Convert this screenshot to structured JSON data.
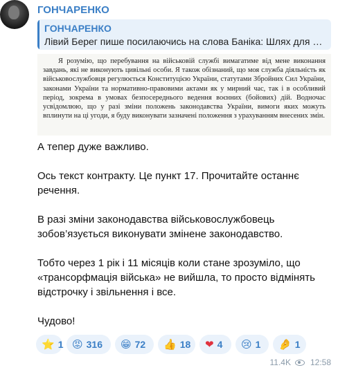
{
  "channel": {
    "sender_name": "ГОНЧАРЕНКО"
  },
  "reply": {
    "name": "ГОНЧАРЕНКО",
    "text": "Лівий Берег пише посилаючись на слова Баніка: Шлях для звільнення — не служба, а отримання відстрочки…"
  },
  "document_excerpt": {
    "text": "Я розумію, що перебування на військовій службі вимагатиме від мене виконання завдань, які не виконують цивільні особи. Я також обізнаний, що моя служба діяльність як військовослужбовця регулюється Конституцією України, статутами Збройних Сил України, законами України та нормативно-правовими актами як у мирний час, так і в особливий період, зокрема в умовах безпосереднього ведення воєнних (бойових) дій. Водночас усвідомлюю, що у разі зміни положень законодавства України, вимоги яких можуть вплинути на ці угоди, я буду виконувати зазначені положення з урахуванням внесених змін."
  },
  "message": {
    "p1": "А тепер дуже важливо.",
    "p2": "Ось текст контракту. Це пункт 17. Прочитайте останнє речення.",
    "p3": "В разі зміни законодавства військовослужбовець зобов’язується виконувати змінене законодавство.",
    "p4": "Тобто через 1 рік і 11 місяців коли стане зрозуміло, що «трансорфмація війська» не вийшла, то просто відмінять відстрочку і звільнення і все.",
    "p5": "Чудово!"
  },
  "reactions": [
    {
      "emoji": "⭐",
      "icon": "star-icon",
      "count": "1"
    },
    {
      "emoji": "😡",
      "icon": "angry-face-icon",
      "count": "316"
    },
    {
      "emoji": "😁",
      "icon": "grin-face-icon",
      "count": "72"
    },
    {
      "emoji": "👍",
      "icon": "thumbs-up-icon",
      "count": "18"
    },
    {
      "emoji": "❤",
      "icon": "heart-icon",
      "count": "4"
    },
    {
      "emoji": "😢",
      "icon": "crying-face-icon",
      "count": "1"
    },
    {
      "emoji": "🤌",
      "icon": "pinched-fingers-icon",
      "count": "1"
    }
  ],
  "footer": {
    "views": "11.4K",
    "time": "12:58"
  },
  "colors": {
    "accent": "#3b7fc6",
    "reaction_bg": "#eaf2fb",
    "reply_bg": "#e8f1fa"
  }
}
